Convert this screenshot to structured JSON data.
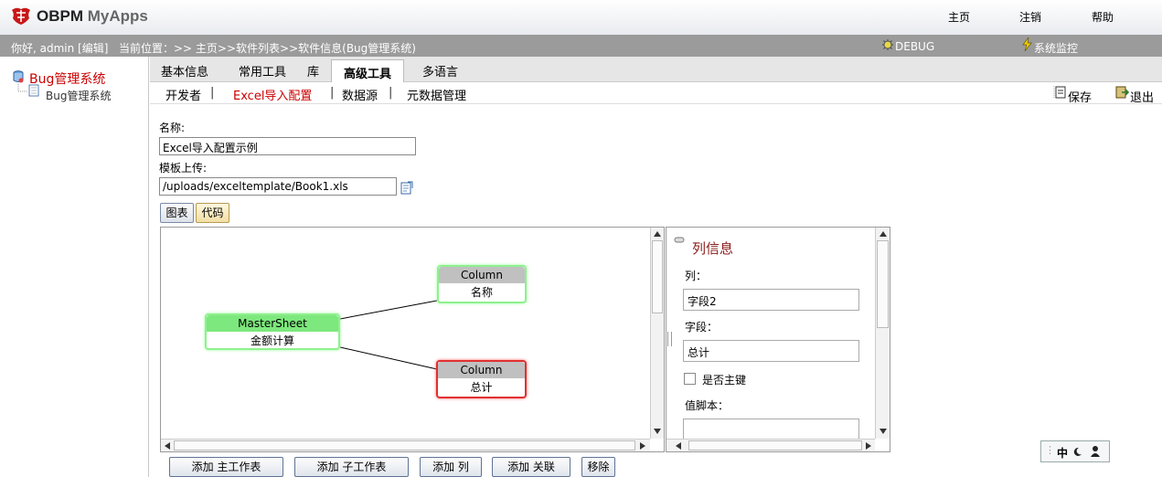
{
  "app": {
    "logo_text": "OBPM",
    "logo_sub": "MyApps"
  },
  "topnav": {
    "home": "主页",
    "logout": "注销",
    "help": "帮助"
  },
  "status": {
    "greeting": "你好, admin [编辑]",
    "location": "当前位置：>> 主页>>软件列表>>软件信息(Bug管理系统)",
    "debug": "DEBUG",
    "monitor": "系统监控"
  },
  "sidebar": {
    "root": "Bug管理系统",
    "child": "Bug管理系统"
  },
  "tabs": [
    "基本信息",
    "常用工具",
    "库",
    "高级工具",
    "多语言"
  ],
  "subtabs": {
    "items": [
      "开发者",
      "Excel导入配置",
      "数据源",
      "元数据管理"
    ],
    "sep": "|"
  },
  "toolbar": {
    "save": "保存",
    "exit": "退出"
  },
  "form": {
    "name_label": "名称:",
    "name_value": "Excel导入配置示例",
    "upload_label": "模板上传:",
    "upload_value": "/uploads/exceltemplate/Book1.xls"
  },
  "view_buttons": {
    "chart": "图表",
    "code": "代码"
  },
  "diagram": {
    "master": {
      "header": "MasterSheet",
      "body": "金额计算"
    },
    "col1": {
      "header": "Column",
      "body": "名称"
    },
    "col2": {
      "header": "Column",
      "body": "总计"
    }
  },
  "panel": {
    "title": "列信息",
    "col_label": "列：",
    "col_value": "字段2",
    "field_label": "字段：",
    "field_value": "总计",
    "pk_label": "是否主键",
    "script_label": "值脚本："
  },
  "bottom_buttons": {
    "add_main": "添加 主工作表",
    "add_sub": "添加 子工作表",
    "add_col": "添加 列",
    "add_rel": "添加 关联",
    "remove": "移除"
  },
  "ime": {
    "lang": "中"
  },
  "colors": {
    "status_bg": "#9b9b9b",
    "node_green": "#7de87d",
    "node_red": "#e03030",
    "title_red": "#8b1a1a"
  }
}
